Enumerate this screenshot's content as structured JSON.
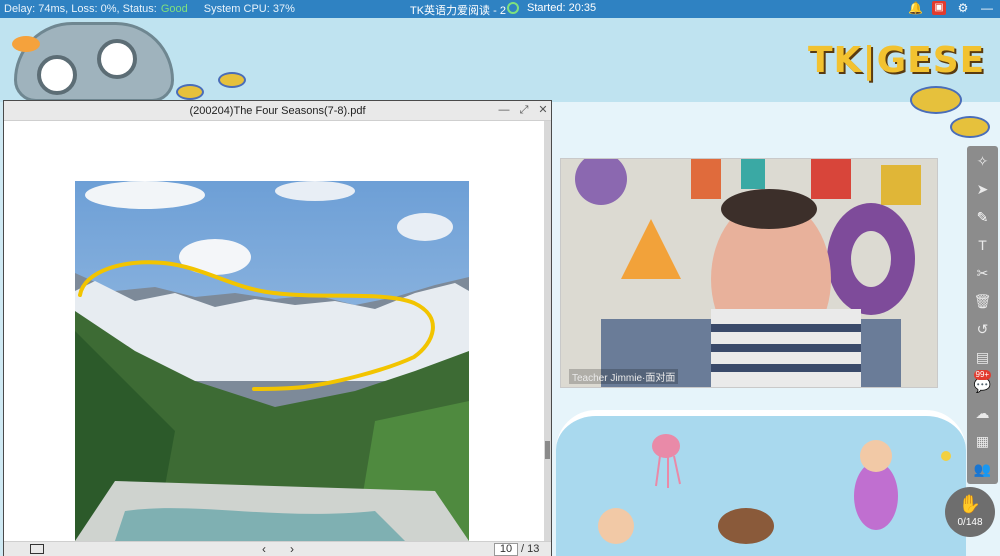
{
  "status": {
    "delay": "Delay: 74ms, Loss: 0%, Status:",
    "status_value": "Good",
    "cpu": "System CPU: 37%",
    "class_title": "TK英语力爱阅读 - 2",
    "started": "Started: 20:35"
  },
  "brand": {
    "logo": "TK|GESE"
  },
  "pdf": {
    "title": "(200204)The Four Seasons(7-8).pdf",
    "current_page": "10",
    "total_pages": "/ 13"
  },
  "video": {
    "name_label": "Teacher Jimmie·面对面"
  },
  "toolbar": {
    "chat_badge": "99+"
  },
  "hand": {
    "count": "0/148"
  },
  "colors": {
    "accent": "#2f82c2",
    "annotation": "#f2c400",
    "good": "#7ee07e"
  }
}
